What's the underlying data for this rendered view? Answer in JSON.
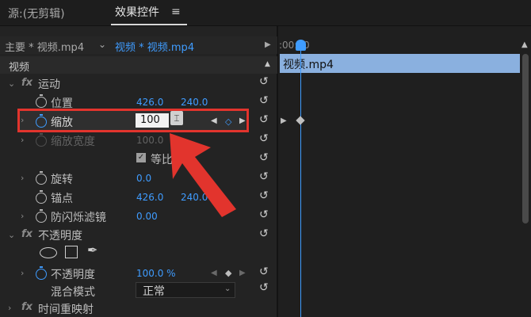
{
  "header": {
    "source_tab": "源:(无剪辑)",
    "effects_tab": "效果控件",
    "menu_glyph": "≡"
  },
  "clipbar": {
    "master": "主要 * 视频.mp4",
    "current": "视频 * 视频.mp4"
  },
  "section": {
    "label": "视频"
  },
  "timeline": {
    "time": ":00:00",
    "clip_label": "视频.mp4"
  },
  "motion": {
    "label": "运动",
    "position": {
      "label": "位置",
      "x": "426.0",
      "y": "240.0"
    },
    "scale": {
      "label": "缩放",
      "value": "100"
    },
    "scale_width": {
      "label": "缩放宽度",
      "value": "100.0"
    },
    "uniform_scale": {
      "label": "等比缩放",
      "visible_text": "等比"
    },
    "rotation": {
      "label": "旋转",
      "value": "0.0"
    },
    "anchor": {
      "label": "锚点",
      "x": "426.0",
      "y": "240.0"
    },
    "anti_flicker": {
      "label": "防闪烁滤镜",
      "value": "0.00"
    }
  },
  "opacity": {
    "label": "不透明度",
    "opacity_row": {
      "label": "不透明度",
      "value": "100.0 %"
    },
    "blend_mode": {
      "label": "混合模式",
      "value": "正常"
    }
  },
  "time_remap": {
    "label": "时间重映射"
  },
  "colors": {
    "accent": "#3f9cff",
    "highlight": "#e2342d",
    "clip": "#8ab0df"
  }
}
